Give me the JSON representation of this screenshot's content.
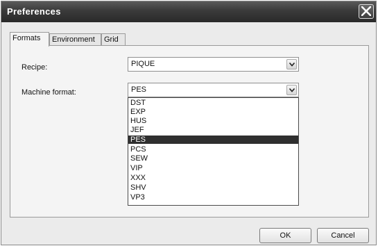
{
  "window": {
    "title": "Preferences"
  },
  "tabs": [
    {
      "label": "Formats",
      "active": true
    },
    {
      "label": "Environment",
      "active": false
    },
    {
      "label": "Grid",
      "active": false
    }
  ],
  "form": {
    "recipe_label": "Recipe:",
    "recipe_value": "PIQUE",
    "machine_format_label": "Machine format:",
    "machine_format_value": "PES"
  },
  "dropdown": {
    "options": [
      "DST",
      "EXP",
      "HUS",
      "JEF",
      "PES",
      "PCS",
      "SEW",
      "VIP",
      "XXX",
      "SHV",
      "VP3"
    ],
    "selected": "PES"
  },
  "buttons": {
    "ok_label": "OK",
    "cancel_label": "Cancel"
  },
  "colors": {
    "selection_bg": "#2f2f2f",
    "titlebar": "#3a3a3a"
  }
}
